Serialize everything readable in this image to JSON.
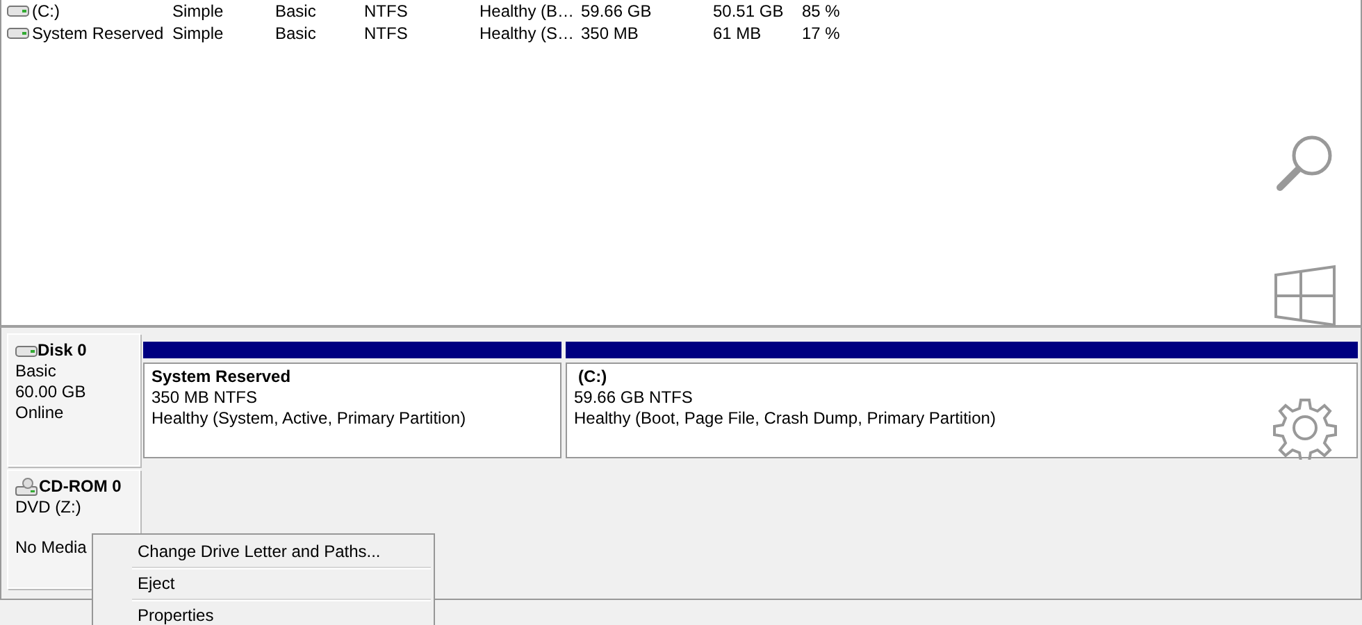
{
  "volume_list": {
    "rows": [
      {
        "volume": "(C:)",
        "layout": "Simple",
        "type": "Basic",
        "file_system": "NTFS",
        "status": "Healthy (B…",
        "capacity": "59.66 GB",
        "free_space": "50.51 GB",
        "percent_free": "85 %"
      },
      {
        "volume": "System Reserved",
        "layout": "Simple",
        "type": "Basic",
        "file_system": "NTFS",
        "status": "Healthy (S…",
        "capacity": "350 MB",
        "free_space": "61 MB",
        "percent_free": "17 %"
      }
    ]
  },
  "disks": [
    {
      "kind": "disk",
      "name": "Disk 0",
      "details": [
        "Basic",
        "60.00 GB",
        "Online"
      ],
      "partitions": [
        {
          "name": "System Reserved",
          "size": "350 MB NTFS",
          "status": "Healthy (System, Active, Primary Partition)"
        },
        {
          "name": "(C:)",
          "size": "59.66 GB NTFS",
          "status": "Healthy (Boot, Page File, Crash Dump, Primary Partition)"
        }
      ]
    },
    {
      "kind": "cdrom",
      "name": "CD-ROM 0",
      "details": [
        "DVD (Z:)"
      ],
      "media": "No Media"
    }
  ],
  "context_menu": {
    "items": [
      "Change Drive Letter and Paths...",
      "Eject",
      "Properties"
    ]
  }
}
